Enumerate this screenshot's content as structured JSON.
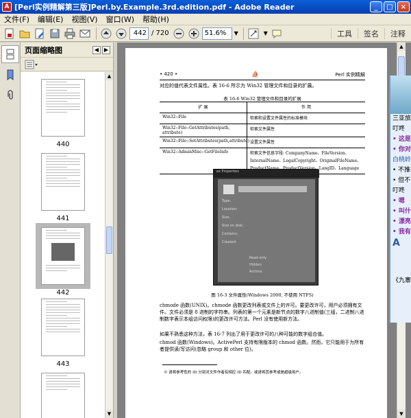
{
  "window": {
    "title": "[Perl实例精解第三版]Perl.by.Example.3rd.edition.pdf - Adobe Reader",
    "minimize": "_",
    "maximize": "□",
    "close": "×"
  },
  "menu": [
    "文件(F)",
    "编辑(E)",
    "视图(V)",
    "窗口(W)",
    "帮助(H)"
  ],
  "toolbar": {
    "current_page": "442",
    "page_total": "/ 720",
    "zoom": "51.6%",
    "right_links": [
      "工具",
      "签名",
      "注释"
    ]
  },
  "thumbnails": {
    "panel_title": "页面缩略图",
    "pages": [
      "440",
      "441",
      "442",
      "443"
    ],
    "selected": "442"
  },
  "document": {
    "header_page": "• 420 •",
    "header_book": "Perl 实例精解",
    "intro": "对应的值代表文件属性。表 16-6 所示为 Win32 管理文件和目录的扩展。",
    "table_caption": "表 16-6   Win32 管理文件和目录的扩展",
    "table_headers": [
      "扩  展",
      "作  用"
    ],
    "table_rows": [
      [
        "Win32::File",
        "检索和设置文件属性的标准模块"
      ],
      [
        "Win32::File::GetAttributes(path, attribute)",
        "检索文件属性"
      ],
      [
        "Win32::File::SetAttributes(path,attribute)",
        "设置文件属性"
      ],
      [
        "Win32::AdminMisc::GetFileInfo",
        "检索文件信息字段: CompanyName、FileVersion、InternalName、LegalCopyright、OriginalFileName、ProductName、ProductVersion、LangID、Language"
      ]
    ],
    "fig_caption": "图 16-3   文件属性(Windows 2000, 不使用 NTFS)",
    "para1": "chmode 函数(UNIX)。chmode 函数更改列表或文件上的许可。要更改许可，用户必须拥有文件。文件必须是 8 进制的字符串。列表的第一个元素是新节点的数字八进制值(三组，二进制八进制数字表示本组访问权限)的更改许可方法。Perl 没有使用新方法。",
    "para2": "如果不熟悉这种方法，表 16-7 列出了用于更改许可的八种可能的数字组合值。",
    "para3": "chmod 函数(Windows)。ActivePerl 支持有限版本的 chmod 函数。然而，它只能用于为所有者提供读/写访问(忽略 group 和 other 位)。",
    "footnote": "④ 请将参考性的 ID 分别对文件作者有相应 ID 匹配。或请将其参考或是超级用户。",
    "shot_title": "ex Properties",
    "shot_fields": [
      "Type:",
      "Location:",
      "Size:",
      "Size on disk:",
      "Contains:",
      "Created:"
    ],
    "shot_attrs": [
      "Read-only",
      "Hidden",
      "Archive"
    ]
  },
  "sidewin": {
    "lines": [
      "三亚旅",
      "叮咚",
      "• 这是",
      "• 你对",
      "白桃岭",
      "• 不推",
      "• 但不",
      "叮咚",
      "• 嗯",
      "• 叫什",
      "• 漂亮",
      "• 我有",
      "A",
      "《九寨"
    ]
  }
}
